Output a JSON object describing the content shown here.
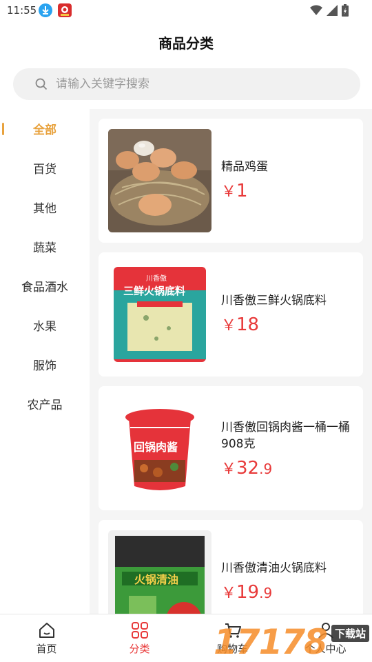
{
  "status_bar": {
    "time": "11:55"
  },
  "header": {
    "title": "商品分类"
  },
  "search": {
    "placeholder": "请输入关键字搜索"
  },
  "sidebar": {
    "active_index": 0,
    "items": [
      {
        "label": "全部"
      },
      {
        "label": "百货"
      },
      {
        "label": "其他"
      },
      {
        "label": "蔬菜"
      },
      {
        "label": "食品酒水"
      },
      {
        "label": "水果"
      },
      {
        "label": "服饰"
      },
      {
        "label": "农产品"
      }
    ]
  },
  "products": [
    {
      "name": "精品鸡蛋",
      "currency": "￥",
      "price_int": "1",
      "price_dec": ""
    },
    {
      "name": "川香傲三鲜火锅底料",
      "currency": "￥",
      "price_int": "18",
      "price_dec": ""
    },
    {
      "name": "川香傲回锅肉酱一桶一桶908克",
      "currency": "￥",
      "price_int": "32",
      "price_dec": ".9"
    },
    {
      "name": "川香傲清油火锅底料",
      "currency": "￥",
      "price_int": "19",
      "price_dec": ".9"
    }
  ],
  "product_images": {
    "p2_banner": "三鲜火锅底料",
    "p2_brand": "川香傲",
    "p3_label": "回锅肉酱",
    "p4_label": "火锅清油"
  },
  "tab_bar": {
    "active_index": 1,
    "items": [
      {
        "label": "首页",
        "icon": "home-icon"
      },
      {
        "label": "分类",
        "icon": "category-icon"
      },
      {
        "label": "购物车",
        "icon": "cart-icon"
      },
      {
        "label": "个人中心",
        "icon": "user-icon"
      }
    ]
  },
  "watermark": {
    "number": "17178",
    "text": "下载站"
  },
  "colors": {
    "accent_orange": "#e8a23d",
    "price_red": "#e83a3a",
    "content_bg": "#f5f5f5",
    "search_bg": "#f1f1f1"
  }
}
